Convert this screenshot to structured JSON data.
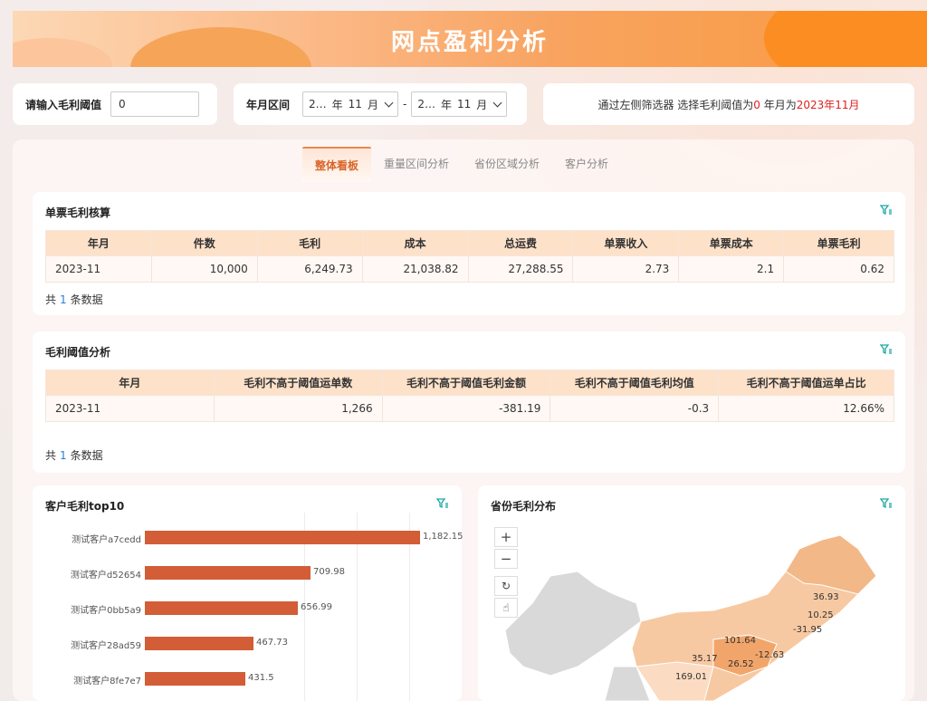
{
  "header": {
    "title": "网点盈利分析"
  },
  "filters": {
    "threshold_label": "请输入毛利阈值",
    "threshold_value": "0",
    "date_label": "年月区间",
    "date_start": {
      "year": "2…",
      "year_suffix": "年",
      "month": "11",
      "month_suffix": "月"
    },
    "date_sep": "-",
    "date_end": {
      "year": "2…",
      "year_suffix": "年",
      "month": "11",
      "month_suffix": "月"
    },
    "summary_prefix": "通过左侧筛选器 选择毛利阈值为",
    "summary_threshold": "0",
    "summary_mid": " 年月为",
    "summary_month": "2023年11月"
  },
  "tabs": [
    "整体看板",
    "重量区间分析",
    "省份区域分析",
    "客户分析"
  ],
  "single_ticket": {
    "title": "单票毛利核算",
    "columns": [
      "年月",
      "件数",
      "毛利",
      "成本",
      "总运费",
      "单票收入",
      "单票成本",
      "单票毛利"
    ],
    "row": [
      "2023-11",
      "10,000",
      "6,249.73",
      "21,038.82",
      "27,288.55",
      "2.73",
      "2.1",
      "0.62"
    ],
    "count_prefix": "共",
    "count": "1",
    "count_suffix": "条数据"
  },
  "threshold_analysis": {
    "title": "毛利阈值分析",
    "columns": [
      "年月",
      "毛利不高于阈值运单数",
      "毛利不高于阈值毛利金额",
      "毛利不高于阈值毛利均值",
      "毛利不高于阈值运单占比"
    ],
    "row": [
      "2023-11",
      "1,266",
      "-381.19",
      "-0.3",
      "12.66%"
    ],
    "count_prefix": "共",
    "count": "1",
    "count_suffix": "条数据"
  },
  "customer_top10": {
    "title": "客户毛利top10"
  },
  "province_map": {
    "title": "省份毛利分布",
    "zoom_in": "+",
    "zoom_out": "−",
    "labels": [
      "36.93",
      "10.25",
      "-31.95",
      "101.64",
      "-12.63",
      "35.17",
      "26.52",
      "169.01"
    ]
  },
  "colors": {
    "accent": "#d9652a",
    "bar": "#d35d36",
    "header_bg": "#fde1c9",
    "highlight": "#e02020",
    "map_fill": "#f7c9a2",
    "map_gray": "#d9d9d9"
  },
  "chart_data": {
    "type": "bar",
    "title": "客户毛利top10",
    "categories": [
      "测试客户a7cedd",
      "测试客户d52654",
      "测试客户0bb5a9",
      "测试客户28ad59",
      "测试客户8fe7e7"
    ],
    "values": [
      1182.15,
      709.98,
      656.99,
      467.73,
      431.5
    ],
    "value_labels": [
      "1,182.15",
      "709.98",
      "656.99",
      "467.73",
      "431.5"
    ],
    "orientation": "horizontal"
  }
}
